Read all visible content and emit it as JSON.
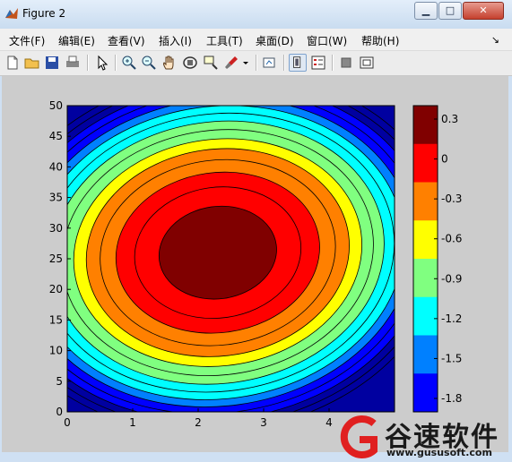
{
  "window": {
    "title": "Figure 2",
    "minimize_label": "▁",
    "maximize_label": "□",
    "close_label": "✕"
  },
  "menubar": {
    "items": [
      {
        "label": "文件(F)"
      },
      {
        "label": "编辑(E)"
      },
      {
        "label": "查看(V)"
      },
      {
        "label": "插入(I)"
      },
      {
        "label": "工具(T)"
      },
      {
        "label": "桌面(D)"
      },
      {
        "label": "窗口(W)"
      },
      {
        "label": "帮助(H)"
      }
    ],
    "overflow_label": "↘"
  },
  "toolbar": {
    "icons": [
      "new-figure-icon",
      "open-file-icon",
      "save-icon",
      "print-icon",
      "edit-plot-arrow-icon",
      "zoom-in-icon",
      "zoom-out-icon",
      "pan-hand-icon",
      "rotate-3d-icon",
      "data-cursor-icon",
      "brush-icon",
      "brush-dropdown-icon",
      "link-plot-icon",
      "colorbar-icon",
      "legend-icon",
      "hide-plot-tools-icon",
      "show-plot-tools-icon"
    ]
  },
  "chart_data": {
    "type": "contour",
    "title": "",
    "xlabel": "",
    "ylabel": "",
    "x_ticks": [
      "0",
      "1",
      "2",
      "3",
      "4"
    ],
    "y_ticks": [
      "0",
      "5",
      "10",
      "15",
      "20",
      "25",
      "30",
      "35",
      "40",
      "45",
      "50"
    ],
    "xlim": [
      0,
      5
    ],
    "ylim": [
      0,
      50
    ],
    "grid": false,
    "center": {
      "x": 2.3,
      "y": 26
    },
    "levels": [
      -1.8,
      -1.65,
      -1.5,
      -1.35,
      -1.2,
      -1.05,
      -0.9,
      -0.75,
      -0.6,
      -0.45,
      -0.3,
      -0.15,
      0,
      0.15,
      0.3
    ],
    "band_colors": [
      "#0000a0",
      "#0000ff",
      "#0080ff",
      "#00ffff",
      "#80ff80",
      "#ffff00",
      "#ff8000",
      "#ff0000",
      "#800000"
    ],
    "colorbar": {
      "ticks": [
        "0.3",
        "0",
        "-0.3",
        "-0.6",
        "-0.9",
        "-1.2",
        "-1.5",
        "-1.8"
      ],
      "colors": [
        "#800000",
        "#ff0000",
        "#ff8000",
        "#ffff00",
        "#80ff80",
        "#00ffff",
        "#0080ff",
        "#0000ff"
      ]
    }
  },
  "watermark": {
    "text": "谷速软件",
    "url": "www.gususoft.com"
  }
}
